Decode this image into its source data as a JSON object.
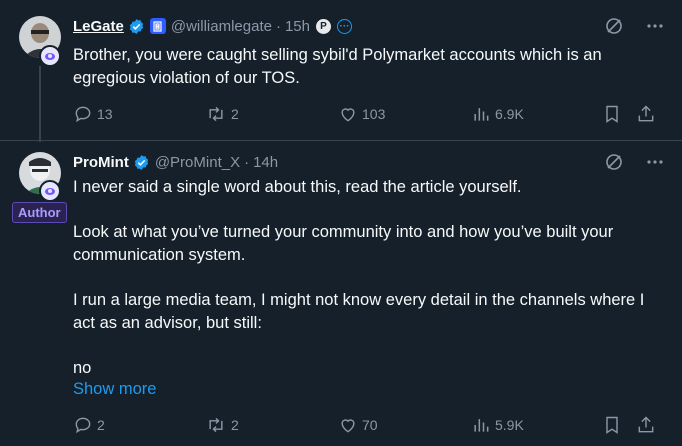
{
  "tweets": [
    {
      "name": "LeGate",
      "handle": "@williamlegate",
      "time": "15h",
      "text": [
        "Brother, you were caught selling sybil'd Polymarket accounts which is an egregious violation of our TOS."
      ],
      "stats": {
        "replies": "13",
        "reposts": "2",
        "likes": "103",
        "views": "6.9K"
      },
      "icons": [
        "reply-icon",
        "repost-icon",
        "like-icon",
        "views-icon",
        "bookmark-icon",
        "share-icon",
        "grok-icon",
        "more-icon"
      ]
    },
    {
      "name": "ProMint",
      "handle": "@ProMint_X",
      "time": "14h",
      "author_label": "Author",
      "text": [
        "I never said a single word about this, read the article yourself.",
        "Look at what you’ve turned your community into and how you’ve built your communication system.",
        "I run a large media team, I might not know every detail in the channels where I act as an advisor, but still:",
        "no"
      ],
      "show_more": "Show more",
      "stats": {
        "replies": "2",
        "reposts": "2",
        "likes": "70",
        "views": "5.9K"
      }
    }
  ],
  "colors": {
    "background": "#15202b",
    "text": "#f7f9f9",
    "muted": "#8b98a5",
    "link": "#1d9bf0",
    "verified": "#1d9bf0",
    "author_badge": "#a99bff"
  }
}
